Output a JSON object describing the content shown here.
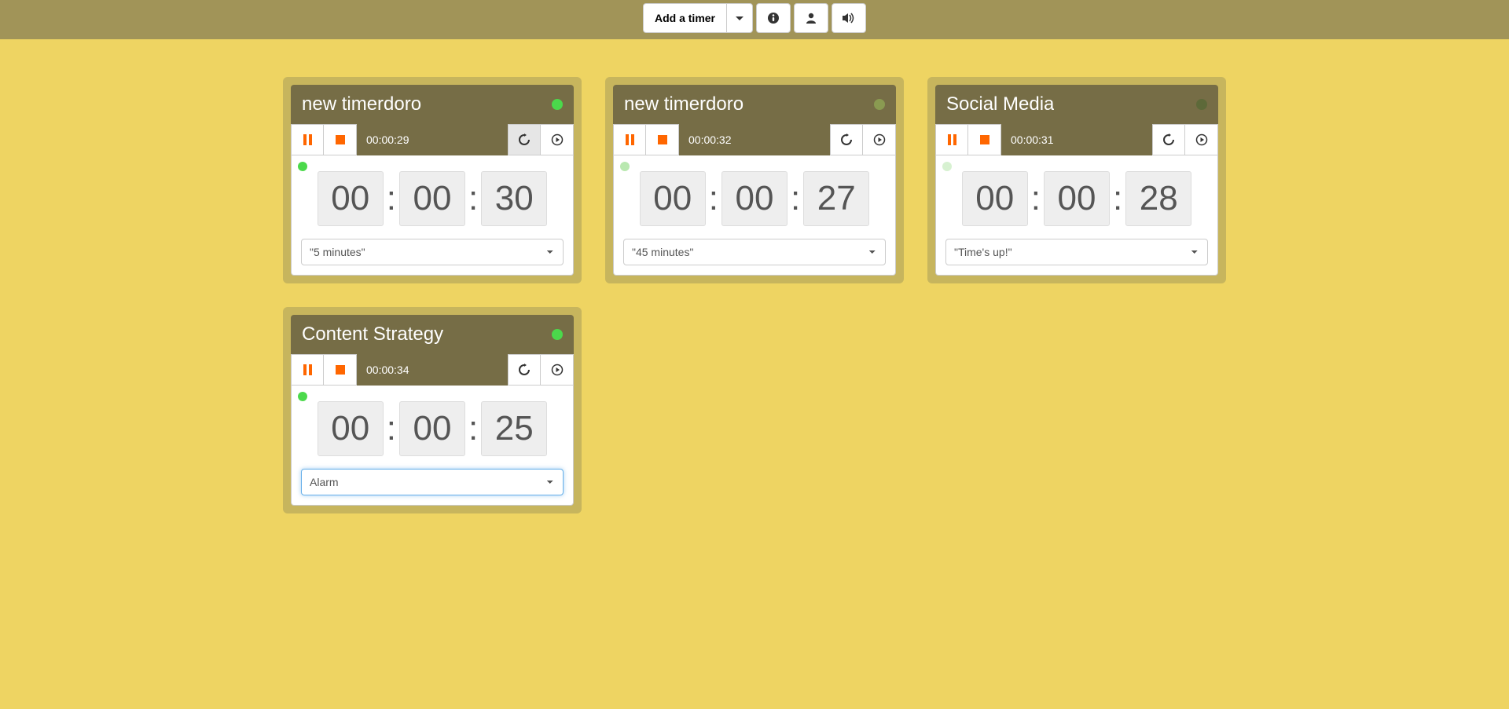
{
  "toolbar": {
    "add_label": "Add a timer"
  },
  "timers": [
    {
      "title": "new timerdoro",
      "header_dot": "dot-green",
      "elapsed": "00:00:29",
      "body_dot": "sdot-green",
      "hh": "00",
      "mm": "00",
      "ss": "30",
      "alarm": "\"5 minutes\"",
      "refresh_active": true,
      "select_focused": false
    },
    {
      "title": "new timerdoro",
      "header_dot": "dot-olive",
      "elapsed": "00:00:32",
      "body_dot": "sdot-pale",
      "hh": "00",
      "mm": "00",
      "ss": "27",
      "alarm": "\"45 minutes\"",
      "refresh_active": false,
      "select_focused": false
    },
    {
      "title": "Social Media",
      "header_dot": "dot-dark",
      "elapsed": "00:00:31",
      "body_dot": "sdot-vpale",
      "hh": "00",
      "mm": "00",
      "ss": "28",
      "alarm": "\"Time's up!\"",
      "refresh_active": false,
      "select_focused": false
    },
    {
      "title": "Content Strategy",
      "header_dot": "dot-green",
      "elapsed": "00:00:34",
      "body_dot": "sdot-green",
      "hh": "00",
      "mm": "00",
      "ss": "25",
      "alarm": "Alarm",
      "refresh_active": false,
      "select_focused": true
    }
  ]
}
